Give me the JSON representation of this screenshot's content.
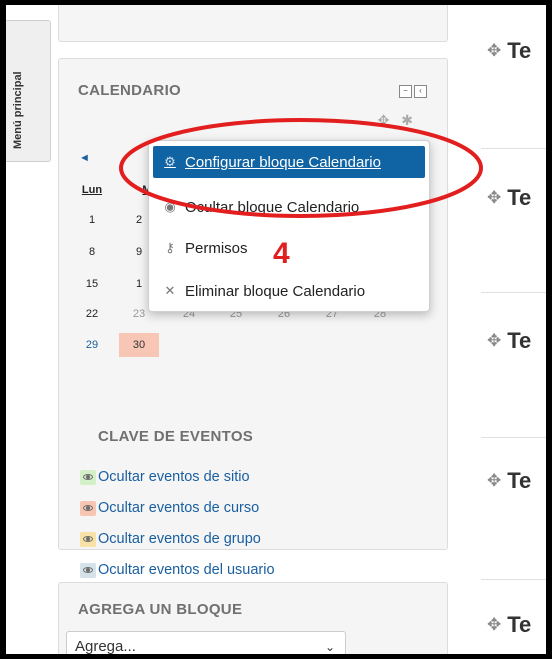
{
  "side_tab": {
    "label": "Menú principal"
  },
  "calendar_block": {
    "title": "CALENDARIO",
    "controls": [
      "−",
      "‹"
    ],
    "prev_month": "◄",
    "weekday_headers": [
      "Lun",
      "M"
    ],
    "days": [
      [
        "1",
        "2"
      ],
      [
        "8",
        "9"
      ],
      [
        "15",
        "1"
      ],
      [
        "22",
        "23",
        "24",
        "25",
        "26",
        "27",
        "28"
      ],
      [
        "29",
        "30"
      ]
    ],
    "today": "30"
  },
  "event_key": {
    "title": "CLAVE DE EVENTOS",
    "items": [
      {
        "label": "Ocultar eventos de sitio",
        "color": "#d3f0c8"
      },
      {
        "label": "Ocultar eventos de curso",
        "color": "#f6c6b2"
      },
      {
        "label": "Ocultar eventos de grupo",
        "color": "#f7e1a6"
      },
      {
        "label": "Ocultar eventos del usuario",
        "color": "#d5e2ea"
      }
    ]
  },
  "add_block": {
    "title": "AGREGA UN BLOQUE",
    "select_value": "Agrega..."
  },
  "dropdown_menu": {
    "items": [
      {
        "label": "Configurar bloque Calendario",
        "icon": "gear-icon"
      },
      {
        "label": "Ocultar bloque Calendario",
        "icon": "eye-icon"
      },
      {
        "label": "Permisos",
        "icon": "key-icon"
      },
      {
        "label": "Eliminar bloque Calendario",
        "icon": "x-icon"
      }
    ]
  },
  "annotation": {
    "step": "4",
    "highlight_color": "#e21e1e"
  },
  "right_column": {
    "items": [
      "Te",
      "Te",
      "Te",
      "Te",
      "Te"
    ]
  },
  "colors": {
    "link": "#1a5fa0",
    "active_menu": "#1164a3"
  }
}
